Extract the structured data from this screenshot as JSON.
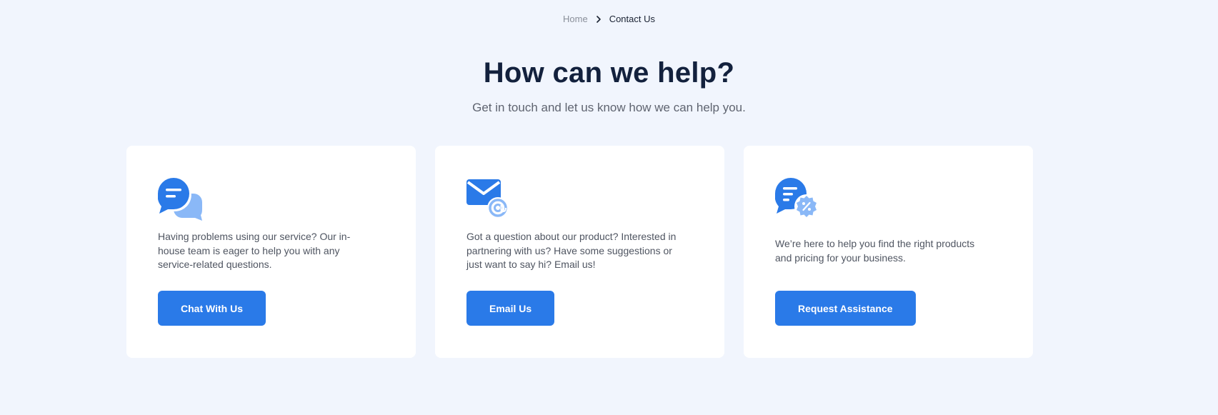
{
  "breadcrumb": {
    "home": "Home",
    "current": "Contact Us"
  },
  "header": {
    "title": "How can we help?",
    "subtitle": "Get in touch and let us know how we can help you."
  },
  "cards": [
    {
      "icon": "chat-bubbles-icon",
      "text": "Having problems using our service? Our in-house team is eager to help you with any service-related questions.",
      "button": "Chat With Us"
    },
    {
      "icon": "envelope-at-icon",
      "text": "Got a question about our product? Interested in partnering with us? Have some suggestions or just want to say hi? Email us!",
      "button": "Email Us"
    },
    {
      "icon": "chat-discount-icon",
      "text": "We’re here to help you find the right products and pricing for your business.",
      "button": "Request Assistance"
    }
  ],
  "colors": {
    "background": "#f1f5fd",
    "primary": "#2a7ae8",
    "icon_light": "#8ab8f7",
    "title": "#13213d",
    "body_text": "#4f5561"
  }
}
